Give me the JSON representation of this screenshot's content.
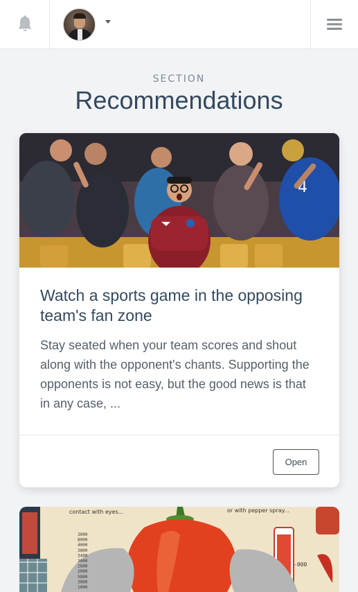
{
  "header": {
    "notifications_icon": "bell-icon",
    "avatar_alt": "User avatar",
    "dropdown_icon": "caret-down-icon",
    "menu_icon": "hamburger-menu-icon"
  },
  "section": {
    "eyebrow": "SECTION",
    "title": "Recommendations"
  },
  "cards": [
    {
      "image": "fans-stadium-illustration",
      "title": "Watch a sports game in the opposing team's fan zone",
      "text": "Stay seated when your team scores and shout along with the opponent's chants. Supporting the opponents is not easy, but the good news is that in any case, ...",
      "button_label": "Open"
    },
    {
      "image": "chili-pepper-illustration",
      "image_text_left": "contact with eyes...",
      "image_text_right": "or with pepper spray...",
      "scale_values": [
        "3000",
        "8000",
        "4000",
        "3800",
        "3400",
        "3000",
        "2600",
        "2000",
        "5800",
        "3000",
        "1000"
      ],
      "scale_marker": "-000"
    }
  ]
}
